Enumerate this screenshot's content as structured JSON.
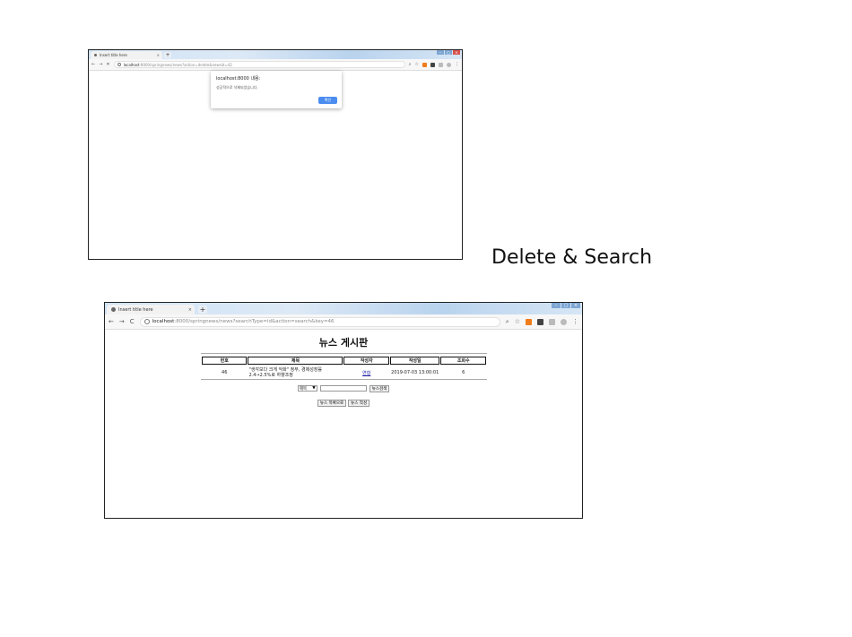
{
  "caption": "Delete & Search",
  "screenshot1": {
    "tab_title": "Insert title here",
    "tab_close": "×",
    "new_tab": "+",
    "window_controls": [
      "–",
      "□",
      "×"
    ],
    "nav": {
      "back": "←",
      "forward": "→",
      "reload": "✕"
    },
    "url_host": "localhost",
    "url_path": ":8000/springnews/news?action=delete&newsid=42",
    "toolbar_icons": [
      "search-icon",
      "star-icon",
      "extension-icons",
      "avatar-icon",
      "menu-icon"
    ],
    "dialog": {
      "title": "localhost:8000 내용:",
      "message": "성공적으로 삭제되었습니다.",
      "ok_label": "확인",
      "ok_color": "#4a8cf0"
    }
  },
  "screenshot2": {
    "tab_title": "Insert title here",
    "tab_close": "×",
    "new_tab": "+",
    "window_controls": [
      "–",
      "□",
      "×"
    ],
    "nav": {
      "back": "←",
      "forward": "→",
      "reload": "C"
    },
    "url_host": "localhost",
    "url_path": ":8000/springnews/news?searchType=id&action=search&key=46",
    "page": {
      "title": "뉴스 게시판",
      "columns": [
        "번호",
        "제목",
        "작성자",
        "작성일",
        "조회수"
      ],
      "rows": [
        {
          "no": "46",
          "subject_line1": "\"생각보다 크게 악화\" 정부, 경제성장률",
          "subject_line2": "2.4→2.5%로 하향조정",
          "author": "연합",
          "date": "2019-07-03 13:00:01",
          "views": "6"
        }
      ],
      "search": {
        "select_value": "제목",
        "select_arrow": "▼",
        "input_value": "",
        "search_button": "뉴스검색"
      },
      "actions": {
        "list_button": "뉴스 목록으로",
        "write_button": "뉴스 작성"
      }
    }
  }
}
